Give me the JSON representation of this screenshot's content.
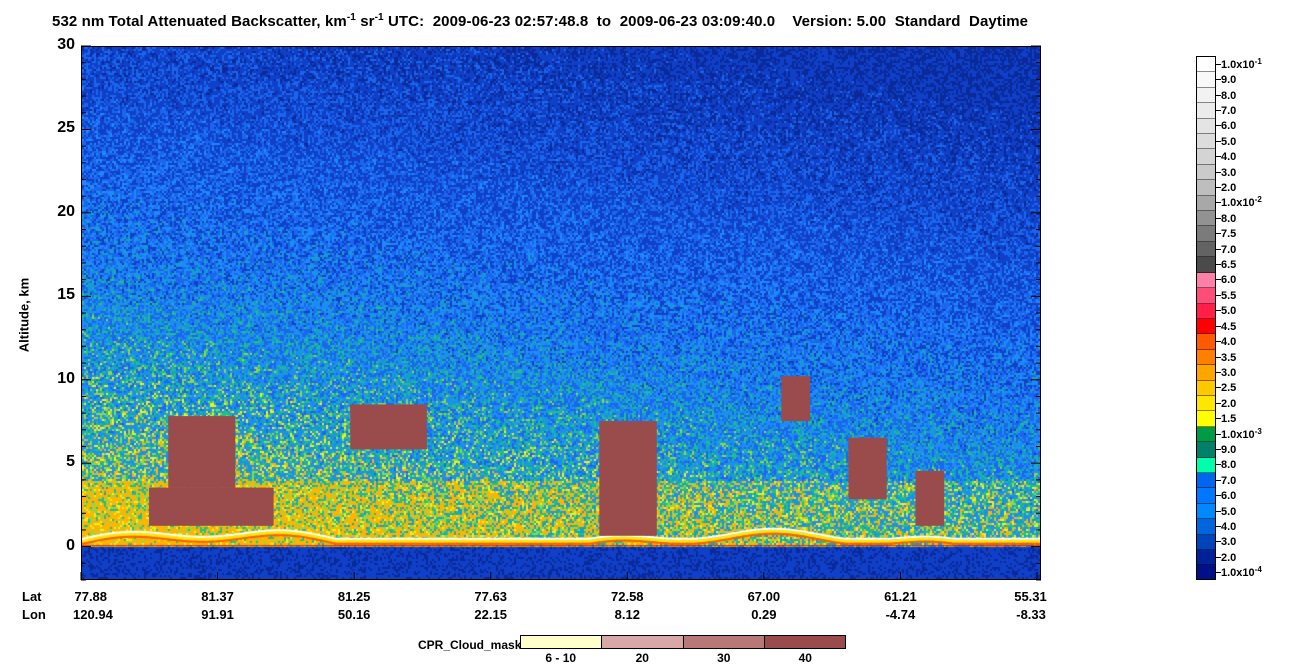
{
  "header": {
    "title_main": "532 nm Total Attenuated Backscatter, km",
    "title_sup1": "-1",
    "title_unit2": " sr",
    "title_sup2": "-1",
    "title_rest": "UTC:  2009-06-23 02:57:48.8  to  2009-06-23 03:09:40.0    Version: 5.00  Standard  Daytime"
  },
  "chart_data": {
    "type": "heatmap",
    "ylabel": "Altitude, km",
    "ylim": [
      -2,
      30
    ],
    "yticks": [
      0,
      5,
      10,
      15,
      20,
      25,
      30
    ],
    "x_rows": [
      {
        "name": "Lat",
        "values": [
          "77.88",
          "81.37",
          "81.25",
          "77.63",
          "72.58",
          "67.00",
          "61.21",
          "55.31"
        ]
      },
      {
        "name": "Lon",
        "values": [
          "120.94",
          "91.91",
          "50.16",
          "22.15",
          "8.12",
          "0.29",
          "-4.74",
          "-8.33"
        ]
      }
    ],
    "surface_altitude_km": 0,
    "cloud_mask_regions": [
      {
        "x": [
          0.09,
          0.16
        ],
        "y": [
          3.5,
          7.8
        ],
        "mask": 40
      },
      {
        "x": [
          0.07,
          0.2
        ],
        "y": [
          1.2,
          3.5
        ],
        "mask": 40
      },
      {
        "x": [
          0.28,
          0.36
        ],
        "y": [
          5.8,
          8.5
        ],
        "mask": 40
      },
      {
        "x": [
          0.54,
          0.6
        ],
        "y": [
          0.6,
          7.5
        ],
        "mask": 40
      },
      {
        "x": [
          0.73,
          0.76
        ],
        "y": [
          7.5,
          10.2
        ],
        "mask": 40
      },
      {
        "x": [
          0.8,
          0.84
        ],
        "y": [
          2.8,
          6.5
        ],
        "mask": 40
      },
      {
        "x": [
          0.87,
          0.9
        ],
        "y": [
          1.2,
          4.5
        ],
        "mask": 40
      }
    ]
  },
  "colorbar": {
    "labels": [
      "1.0x10^-1",
      "9.0",
      "8.0",
      "7.0",
      "6.0",
      "5.0",
      "4.0",
      "3.0",
      "2.0",
      "1.0x10^-2",
      "8.0",
      "7.5",
      "7.0",
      "6.5",
      "6.0",
      "5.5",
      "5.0",
      "4.5",
      "4.0",
      "3.5",
      "3.0",
      "2.5",
      "2.0",
      "1.5",
      "1.0x10^-3",
      "9.0",
      "8.0",
      "7.0",
      "6.0",
      "5.0",
      "4.0",
      "3.0",
      "2.0",
      "1.0x10^-4"
    ],
    "colors": [
      "#ffffff",
      "#f8f8f8",
      "#f2f2f2",
      "#ebebeb",
      "#e4e4e4",
      "#dcdcdc",
      "#d4d4d4",
      "#cacaca",
      "#bebebe",
      "#a8a8a8",
      "#929292",
      "#7b7b7b",
      "#636363",
      "#4a4a4a",
      "#ff7fa8",
      "#ff4d79",
      "#ff1f47",
      "#ff0000",
      "#ff5a00",
      "#ff8000",
      "#ffa500",
      "#ffc800",
      "#ffe600",
      "#ffff00",
      "#009944",
      "#00806a",
      "#00ffaa",
      "#0066ee",
      "#0077ff",
      "#0088ff",
      "#0066dd",
      "#0044bb",
      "#002299",
      "#001188"
    ]
  },
  "cpr_legend": {
    "title": "CPR_Cloud_mask",
    "labels": [
      "6 - 10",
      "20",
      "30",
      "40"
    ],
    "colors": [
      "#ffffcc",
      "#d8a8a8",
      "#b87878",
      "#9a4c4c"
    ]
  }
}
